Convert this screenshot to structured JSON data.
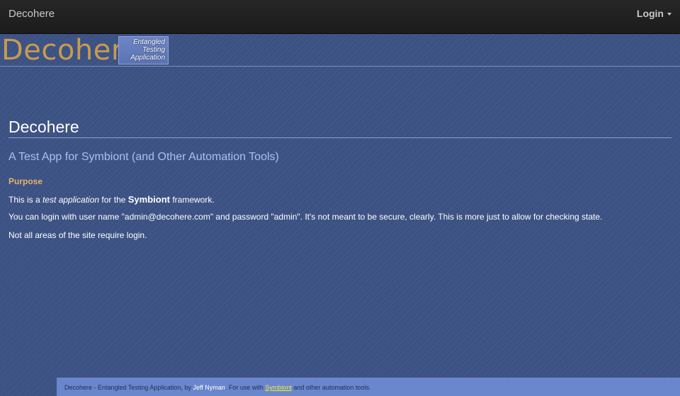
{
  "navbar": {
    "brand": "Decohere",
    "login_label": "Login"
  },
  "logo": {
    "title": "Decohere",
    "badge_lines": [
      "Entangled",
      "Testing",
      "Application"
    ]
  },
  "main": {
    "heading": "Decohere",
    "subheading": "A Test App for Symbiont (and Other Automation Tools)",
    "section_title": "Purpose",
    "p1": {
      "before": "This is a ",
      "emphasis": "test application",
      "middle": " for the ",
      "strong": "Symbiont",
      "after": " framework."
    },
    "p2": "You can login with user name \"admin@decohere.com\" and password \"admin\". It's not meant to be secure, clearly. This is more just to allow for checking state.",
    "p3": "Not all areas of the site require login."
  },
  "footer": {
    "prefix": "Decohere - Entangled Testing Application, by ",
    "author": "Jeff Nyman",
    "middle": ". For use with ",
    "link": "Symbiont",
    "suffix": " and other automation tools."
  },
  "colors": {
    "background": "#3b5285",
    "navbar": "#222222",
    "logo_text": "#c89a50",
    "subheading": "#a8c0f0",
    "section_title": "#e8b26a",
    "footer_bg": "#6a86cc",
    "footer_link": "#f5ef30"
  }
}
